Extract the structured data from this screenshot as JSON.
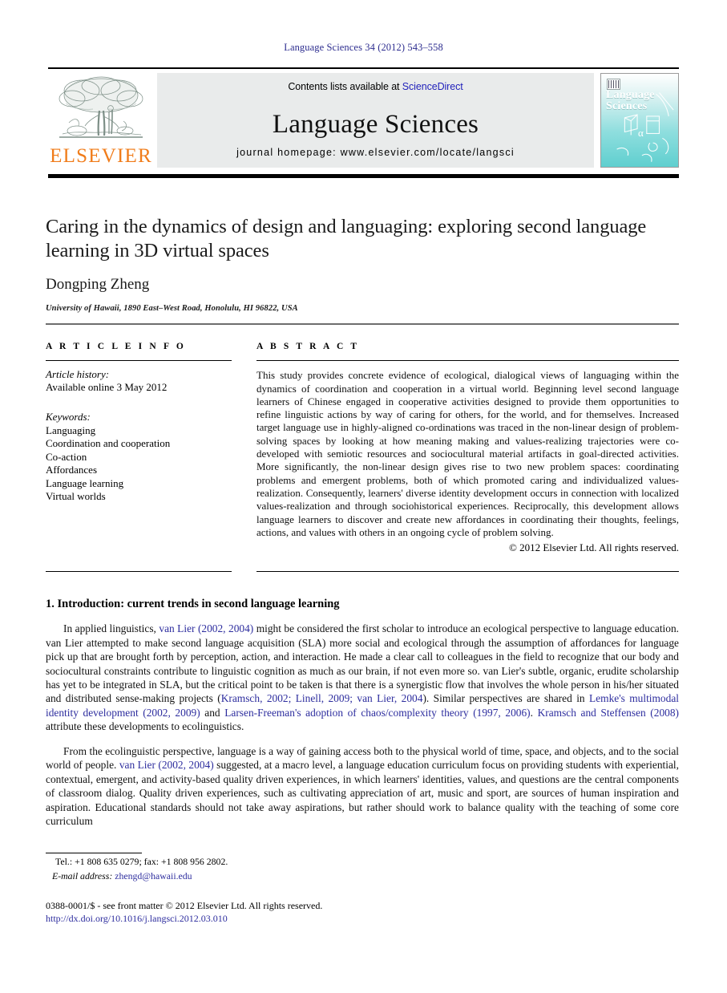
{
  "running_head": "Language Sciences 34 (2012) 543–558",
  "masthead": {
    "contents_prefix": "Contents lists available at ",
    "sciencedirect": "ScienceDirect",
    "journal_title": "Language Sciences",
    "homepage": "journal homepage: www.elsevier.com/locate/langsci",
    "publisher": "ELSEVIER",
    "cover": {
      "line1": "Language",
      "line2": "Sciences",
      "alpha": "α"
    }
  },
  "title_block": {
    "title": "Caring in the dynamics of design and languaging: exploring second language learning in 3D virtual spaces",
    "author": "Dongping Zheng",
    "affiliation": "University of Hawaii, 1890 East–West Road, Honolulu, HI 96822, USA"
  },
  "article_info": {
    "heading": "A R T I C L E    I N F O",
    "history_label": "Article history:",
    "history_value": "Available online 3 May 2012",
    "keywords_label": "Keywords:",
    "keywords": [
      "Languaging",
      "Coordination and cooperation",
      "Co-action",
      "Affordances",
      "Language learning",
      "Virtual worlds"
    ]
  },
  "abstract": {
    "heading": "A B S T R A C T",
    "text": "This study provides concrete evidence of ecological, dialogical views of languaging within the dynamics of coordination and cooperation in a virtual world. Beginning level second language learners of Chinese engaged in cooperative activities designed to provide them opportunities to refine linguistic actions by way of caring for others, for the world, and for themselves. Increased target language use in highly-aligned co-ordinations was traced in the non-linear design of problem-solving spaces by looking at how meaning making and values-realizing trajectories were co-developed with semiotic resources and sociocultural material artifacts in goal-directed activities. More significantly, the non-linear design gives rise to two new problem spaces: coordinating problems and emergent problems, both of which promoted caring and individualized values-realization. Consequently, learners' diverse identity development occurs in connection with localized values-realization and through sociohistorical experiences. Reciprocally, this development allows language learners to discover and create new affordances in coordinating their thoughts, feelings, actions, and values with others in an ongoing cycle of problem solving.",
    "copyright": "© 2012 Elsevier Ltd. All rights reserved."
  },
  "body": {
    "section_heading": "1. Introduction: current trends in second language learning",
    "p1": {
      "t1": "In applied linguistics, ",
      "l1": "van Lier (2002, 2004)",
      "t2": " might be considered the first scholar to introduce an ecological perspective to language education. van Lier attempted to make second language acquisition (SLA) more social and ecological through the assumption of affordances for language pick up that are brought forth by perception, action, and interaction. He made a clear call to colleagues in the field to recognize that our body and sociocultural constraints contribute to linguistic cognition as much as our brain, if not even more so. van Lier's subtle, organic, erudite scholarship has yet to be integrated in SLA, but the critical point to be taken is that there is a synergistic flow that involves the whole person in his/her situated and distributed sense-making projects (",
      "l2": "Kramsch, 2002; Linell, 2009; van Lier, 2004",
      "t3": "). Similar perspectives are shared in ",
      "l3": "Lemke's multimodal identity development (2002, 2009)",
      "t4": " and ",
      "l4": "Larsen-Freeman's adoption of chaos/complexity theory (1997, 2006)",
      "t5": ". ",
      "l5": "Kramsch and Steffensen (2008)",
      "t6": " attribute these developments to ecolinguistics."
    },
    "p2": {
      "t1": "From the ecolinguistic perspective, language is a way of gaining access both to the physical world of time, space, and objects, and to the social world of people. ",
      "l1": "van Lier (2002, 2004)",
      "t2": " suggested, at a macro level, a language education curriculum focus on providing students with experiential, contextual, emergent, and activity-based quality driven experiences, in which learners' identities, values, and questions are the central components of classroom dialog. Quality driven experiences, such as cultivating appreciation of art, music and sport, are sources of human inspiration and aspiration. Educational standards should not take away aspirations, but rather should work to balance quality with the teaching of some core curriculum"
    }
  },
  "footer": {
    "tel": "Tel.: +1 808 635 0279; fax: +1 808 956 2802.",
    "email_label": "E-mail address:",
    "email": "zhengd@hawaii.edu",
    "issn_line": "0388-0001/$ - see front matter © 2012 Elsevier Ltd. All rights reserved.",
    "doi": "http://dx.doi.org/10.1016/j.langsci.2012.03.010"
  },
  "colors": {
    "link": "#2d2d9e",
    "elsevier_orange": "#f07c1a",
    "panel_grey": "#e9ebeb",
    "cover_teal": "#5fcfcf"
  }
}
